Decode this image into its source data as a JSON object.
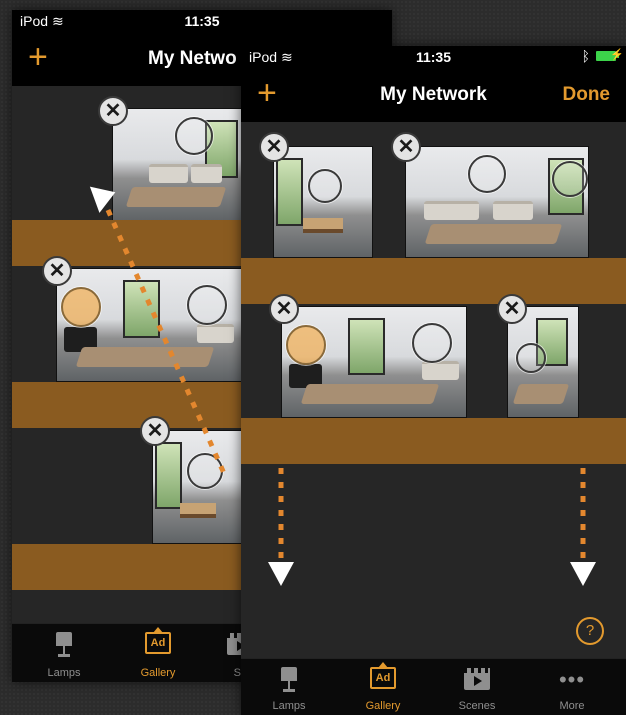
{
  "back_screen": {
    "status": {
      "carrier": "iPod",
      "time": "11:35"
    },
    "nav": {
      "add_label": "+",
      "title": "My Netwo"
    },
    "close_glyph": "✕",
    "tabs": [
      {
        "label": "Lamps",
        "icon": "lamp-icon",
        "active": false
      },
      {
        "label": "Gallery",
        "icon": "gallery-icon",
        "active": true
      },
      {
        "label": "Sc",
        "icon": "scenes-icon",
        "active": false
      }
    ]
  },
  "front_screen": {
    "status": {
      "carrier": "iPod",
      "time": "11:35"
    },
    "nav": {
      "add_label": "+",
      "title": "My Network",
      "done_label": "Done"
    },
    "close_glyph": "✕",
    "help_label": "?",
    "tabs": [
      {
        "label": "Lamps",
        "icon": "lamp-icon",
        "active": false
      },
      {
        "label": "Gallery",
        "icon": "gallery-icon",
        "active": true
      },
      {
        "label": "Scenes",
        "icon": "scenes-icon",
        "active": false
      },
      {
        "label": "More",
        "icon": "more-icon",
        "active": false
      }
    ]
  },
  "colors": {
    "accent": "#e39a2e",
    "room_band": "#8a5b20",
    "lamp_on": "#f5aa46",
    "drag_path": "#e3872e"
  }
}
